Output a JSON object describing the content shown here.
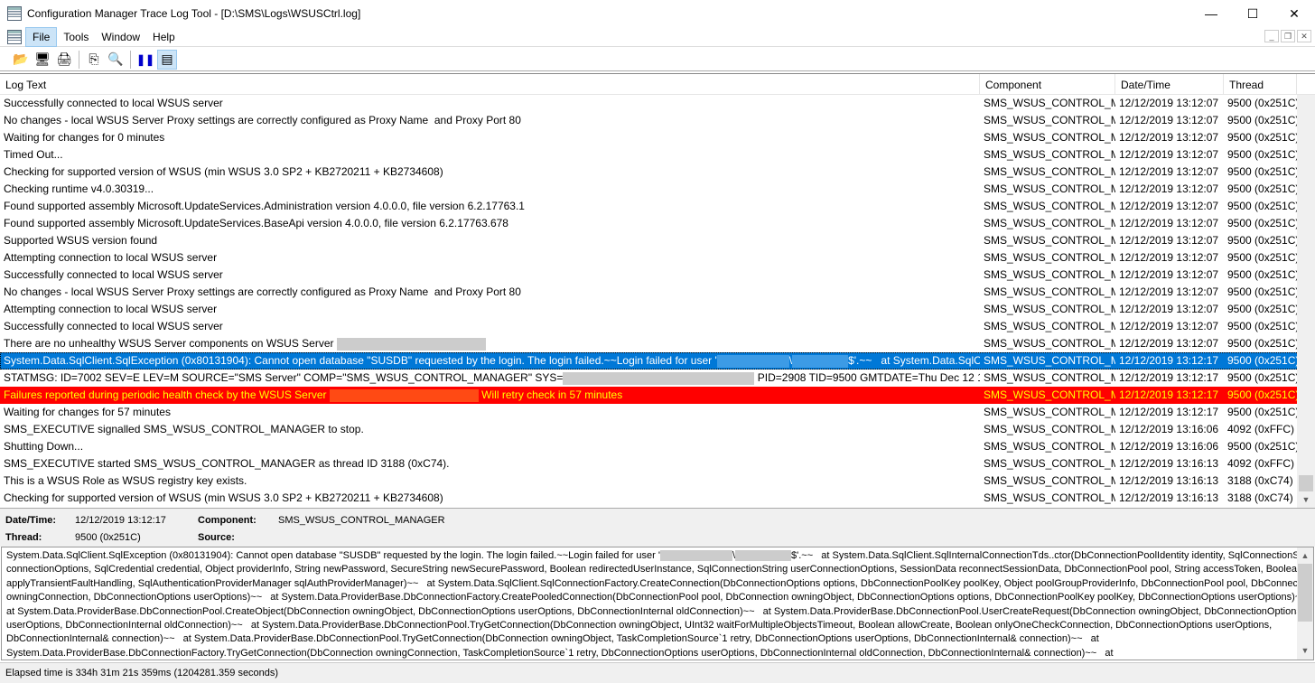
{
  "window": {
    "title": "Configuration Manager Trace Log Tool - [D:\\SMS\\Logs\\WSUSCtrl.log]",
    "minimize": "—",
    "maximize": "☐",
    "close": "✕"
  },
  "menu": [
    "File",
    "Tools",
    "Window",
    "Help"
  ],
  "toolbar": [
    {
      "icon": "open-folder-icon",
      "glyph": "📂"
    },
    {
      "icon": "computer-icon",
      "glyph": "🖥"
    },
    {
      "icon": "print-icon",
      "glyph": "🖨"
    },
    {
      "icon": "copy-icon",
      "glyph": "⎘"
    },
    {
      "icon": "find-icon",
      "glyph": "🔍"
    },
    {
      "icon": "pause-icon",
      "glyph": "❚❚"
    },
    {
      "icon": "details-pane-icon",
      "glyph": "▤"
    }
  ],
  "columns": [
    "Log Text",
    "Component",
    "Date/Time",
    "Thread"
  ],
  "rows": [
    {
      "segs": [
        {
          "t": "Successfully connected to local WSUS server"
        }
      ],
      "component": "SMS_WSUS_CONTROL_MA",
      "datetime": "12/12/2019 13:12:07",
      "thread": "9500 (0x251C)"
    },
    {
      "segs": [
        {
          "t": "No changes - local WSUS Server Proxy settings are correctly configured as Proxy Name  and Proxy Port 80"
        }
      ],
      "component": "SMS_WSUS_CONTROL_MA",
      "datetime": "12/12/2019 13:12:07",
      "thread": "9500 (0x251C)"
    },
    {
      "segs": [
        {
          "t": "Waiting for changes for 0 minutes"
        }
      ],
      "component": "SMS_WSUS_CONTROL_MA",
      "datetime": "12/12/2019 13:12:07",
      "thread": "9500 (0x251C)"
    },
    {
      "segs": [
        {
          "t": "Timed Out..."
        }
      ],
      "component": "SMS_WSUS_CONTROL_MA",
      "datetime": "12/12/2019 13:12:07",
      "thread": "9500 (0x251C)"
    },
    {
      "segs": [
        {
          "t": "Checking for supported version of WSUS (min WSUS 3.0 SP2 + KB2720211 + KB2734608)"
        }
      ],
      "component": "SMS_WSUS_CONTROL_MA",
      "datetime": "12/12/2019 13:12:07",
      "thread": "9500 (0x251C)"
    },
    {
      "segs": [
        {
          "t": "Checking runtime v4.0.30319..."
        }
      ],
      "component": "SMS_WSUS_CONTROL_MA",
      "datetime": "12/12/2019 13:12:07",
      "thread": "9500 (0x251C)"
    },
    {
      "segs": [
        {
          "t": "Found supported assembly Microsoft.UpdateServices.Administration version 4.0.0.0, file version 6.2.17763.1"
        }
      ],
      "component": "SMS_WSUS_CONTROL_MA",
      "datetime": "12/12/2019 13:12:07",
      "thread": "9500 (0x251C)"
    },
    {
      "segs": [
        {
          "t": "Found supported assembly Microsoft.UpdateServices.BaseApi version 4.0.0.0, file version 6.2.17763.678"
        }
      ],
      "component": "SMS_WSUS_CONTROL_MA",
      "datetime": "12/12/2019 13:12:07",
      "thread": "9500 (0x251C)"
    },
    {
      "segs": [
        {
          "t": "Supported WSUS version found"
        }
      ],
      "component": "SMS_WSUS_CONTROL_MA",
      "datetime": "12/12/2019 13:12:07",
      "thread": "9500 (0x251C)"
    },
    {
      "segs": [
        {
          "t": "Attempting connection to local WSUS server"
        }
      ],
      "component": "SMS_WSUS_CONTROL_MA",
      "datetime": "12/12/2019 13:12:07",
      "thread": "9500 (0x251C)"
    },
    {
      "segs": [
        {
          "t": "Successfully connected to local WSUS server"
        }
      ],
      "component": "SMS_WSUS_CONTROL_MA",
      "datetime": "12/12/2019 13:12:07",
      "thread": "9500 (0x251C)"
    },
    {
      "segs": [
        {
          "t": "No changes - local WSUS Server Proxy settings are correctly configured as Proxy Name  and Proxy Port 80"
        }
      ],
      "component": "SMS_WSUS_CONTROL_MA",
      "datetime": "12/12/2019 13:12:07",
      "thread": "9500 (0x251C)"
    },
    {
      "segs": [
        {
          "t": "Attempting connection to local WSUS server"
        }
      ],
      "component": "SMS_WSUS_CONTROL_MA",
      "datetime": "12/12/2019 13:12:07",
      "thread": "9500 (0x251C)"
    },
    {
      "segs": [
        {
          "t": "Successfully connected to local WSUS server"
        }
      ],
      "component": "SMS_WSUS_CONTROL_MA",
      "datetime": "12/12/2019 13:12:07",
      "thread": "9500 (0x251C)"
    },
    {
      "segs": [
        {
          "t": "There are no unhealthy WSUS Server components on WSUS Server "
        },
        {
          "r": 165
        }
      ],
      "component": "SMS_WSUS_CONTROL_MA",
      "datetime": "12/12/2019 13:12:07",
      "thread": "9500 (0x251C)"
    },
    {
      "state": "selected",
      "segs": [
        {
          "t": "System.Data.SqlClient.SqlException (0x80131904): Cannot open database \"SUSDB\" requested by the login. The login failed.~~Login failed for user '"
        },
        {
          "r": 80
        },
        {
          "t": "\\"
        },
        {
          "r": 62
        },
        {
          "t": "$'.~~   at System.Data.SqlClie..."
        }
      ],
      "component": "SMS_WSUS_CONTROL_MA",
      "datetime": "12/12/2019 13:12:17",
      "thread": "9500 (0x251C)"
    },
    {
      "segs": [
        {
          "t": "STATMSG: ID=7002 SEV=E LEV=M SOURCE=\"SMS Server\" COMP=\"SMS_WSUS_CONTROL_MANAGER\" SYS="
        },
        {
          "r": 212
        },
        {
          "t": " PID=2908 TID=9500 GMTDATE=Thu Dec 12 13:12:17.6..."
        }
      ],
      "component": "SMS_WSUS_CONTROL_MA",
      "datetime": "12/12/2019 13:12:17",
      "thread": "9500 (0x251C)"
    },
    {
      "state": "error",
      "segs": [
        {
          "t": "Failures reported during periodic health check by the WSUS Server "
        },
        {
          "r": 165
        },
        {
          "t": " Will retry check in 57 minutes"
        }
      ],
      "component": "SMS_WSUS_CONTROL_MA",
      "datetime": "12/12/2019 13:12:17",
      "thread": "9500 (0x251C)"
    },
    {
      "segs": [
        {
          "t": "Waiting for changes for 57 minutes"
        }
      ],
      "component": "SMS_WSUS_CONTROL_MA",
      "datetime": "12/12/2019 13:12:17",
      "thread": "9500 (0x251C)"
    },
    {
      "segs": [
        {
          "t": "SMS_EXECUTIVE signalled SMS_WSUS_CONTROL_MANAGER to stop."
        }
      ],
      "component": "SMS_WSUS_CONTROL_MA",
      "datetime": "12/12/2019 13:16:06",
      "thread": "4092 (0xFFC)"
    },
    {
      "segs": [
        {
          "t": "Shutting Down..."
        }
      ],
      "component": "SMS_WSUS_CONTROL_MA",
      "datetime": "12/12/2019 13:16:06",
      "thread": "9500 (0x251C)"
    },
    {
      "segs": [
        {
          "t": "SMS_EXECUTIVE started SMS_WSUS_CONTROL_MANAGER as thread ID 3188 (0xC74)."
        }
      ],
      "component": "SMS_WSUS_CONTROL_MA",
      "datetime": "12/12/2019 13:16:13",
      "thread": "4092 (0xFFC)"
    },
    {
      "segs": [
        {
          "t": "This is a WSUS Role as WSUS registry key exists."
        }
      ],
      "component": "SMS_WSUS_CONTROL_MA",
      "datetime": "12/12/2019 13:16:13",
      "thread": "3188 (0xC74)"
    },
    {
      "segs": [
        {
          "t": "Checking for supported version of WSUS (min WSUS 3.0 SP2 + KB2720211 + KB2734608)"
        }
      ],
      "component": "SMS_WSUS_CONTROL_MA",
      "datetime": "12/12/2019 13:16:13",
      "thread": "3188 (0xC74)"
    }
  ],
  "details": {
    "datetime_label": "Date/Time:",
    "datetime": "12/12/2019 13:12:17",
    "component_label": "Component:",
    "component": "SMS_WSUS_CONTROL_MANAGER",
    "thread_label": "Thread:",
    "thread": "9500 (0x251C)",
    "source_label": "Source:",
    "source": ""
  },
  "message_lines": [
    [
      {
        "t": "System.Data.SqlClient.SqlException (0x80131904): Cannot open database \"SUSDB\" requested by the login. The login failed.~~Login failed for user '"
      },
      {
        "r": 80
      },
      {
        "t": "\\"
      },
      {
        "r": 62
      },
      {
        "t": "$'.~~   at System.Data.SqlClient.SqlInternalConnectionTds..ctor(DbConnectionPoolIdentity identity, SqlConnectionString"
      }
    ],
    [
      {
        "t": "connectionOptions, SqlCredential credential, Object providerInfo, String newPassword, SecureString newSecurePassword, Boolean redirectedUserInstance, SqlConnectionString userConnectionOptions, SessionData reconnectSessionData, DbConnectionPool pool, String accessToken, Boolean"
      }
    ],
    [
      {
        "t": "applyTransientFaultHandling, SqlAuthenticationProviderManager sqlAuthProviderManager)~~   at System.Data.SqlClient.SqlConnectionFactory.CreateConnection(DbConnectionOptions options, DbConnectionPoolKey poolKey, Object poolGroupProviderInfo, DbConnectionPool pool, DbConnection"
      }
    ],
    [
      {
        "t": "owningConnection, DbConnectionOptions userOptions)~~   at System.Data.ProviderBase.DbConnectionFactory.CreatePooledConnection(DbConnectionPool pool, DbConnection owningObject, DbConnectionOptions options, DbConnectionPoolKey poolKey, DbConnectionOptions userOptions)~~"
      }
    ],
    [
      {
        "t": "at System.Data.ProviderBase.DbConnectionPool.CreateObject(DbConnection owningObject, DbConnectionOptions userOptions, DbConnectionInternal oldConnection)~~   at System.Data.ProviderBase.DbConnectionPool.UserCreateRequest(DbConnection owningObject, DbConnectionOptions"
      }
    ],
    [
      {
        "t": "userOptions, DbConnectionInternal oldConnection)~~   at System.Data.ProviderBase.DbConnectionPool.TryGetConnection(DbConnection owningObject, UInt32 waitForMultipleObjectsTimeout, Boolean allowCreate, Boolean onlyOneCheckConnection, DbConnectionOptions userOptions,"
      }
    ],
    [
      {
        "t": "DbConnectionInternal& connection)~~   at System.Data.ProviderBase.DbConnectionPool.TryGetConnection(DbConnection owningObject, TaskCompletionSource`1 retry, DbConnectionOptions userOptions, DbConnectionInternal& connection)~~   at"
      }
    ],
    [
      {
        "t": "System.Data.ProviderBase.DbConnectionFactory.TryGetConnection(DbConnection owningConnection, TaskCompletionSource`1 retry, DbConnectionOptions userOptions, DbConnectionInternal oldConnection, DbConnectionInternal& connection)~~   at"
      }
    ],
    [
      {
        "t": "System.Data.ProviderBase.DbConnectionInternal.TryOpenConnectionInternal(DbConnection outerConnection, DbConnectionFactory connectionFactory, TaskCompletionSource`1 retry, DbConnectionOptions userOptions)~~   at System.Data.SqlClient.SqlConnection.TryOpenInner"
      }
    ]
  ],
  "status": "Elapsed time is 334h 31m 21s 359ms (1204281.359 seconds)",
  "colors": {
    "selected": "#0078d7",
    "error_bg": "#ff0000",
    "error_text": "#ffff00"
  }
}
